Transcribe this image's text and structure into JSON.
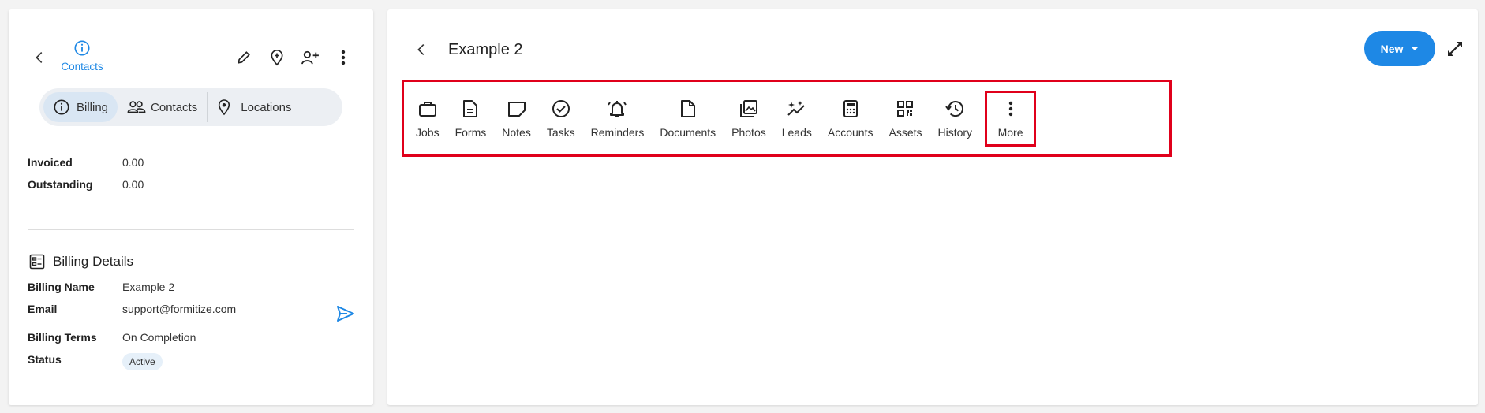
{
  "left": {
    "top_tab_label": "Contacts",
    "segments": [
      "Billing",
      "Contacts",
      "Locations"
    ],
    "financials": [
      {
        "label": "Invoiced",
        "value": "0.00"
      },
      {
        "label": "Outstanding",
        "value": "0.00"
      }
    ],
    "billing_details": {
      "title": "Billing Details",
      "name_label": "Billing Name",
      "name_value": "Example 2",
      "email_label": "Email",
      "email_value": "support@formitize.com",
      "terms_label": "Billing Terms",
      "terms_value": "On Completion",
      "status_label": "Status",
      "status_value": "Active"
    }
  },
  "main": {
    "title": "Example 2",
    "new_button": "New",
    "tools": [
      "Jobs",
      "Forms",
      "Notes",
      "Tasks",
      "Reminders",
      "Documents",
      "Photos",
      "Leads",
      "Accounts",
      "Assets",
      "History",
      "More"
    ]
  },
  "colors": {
    "accent": "#1e88e5",
    "highlight": "#e0001b"
  }
}
